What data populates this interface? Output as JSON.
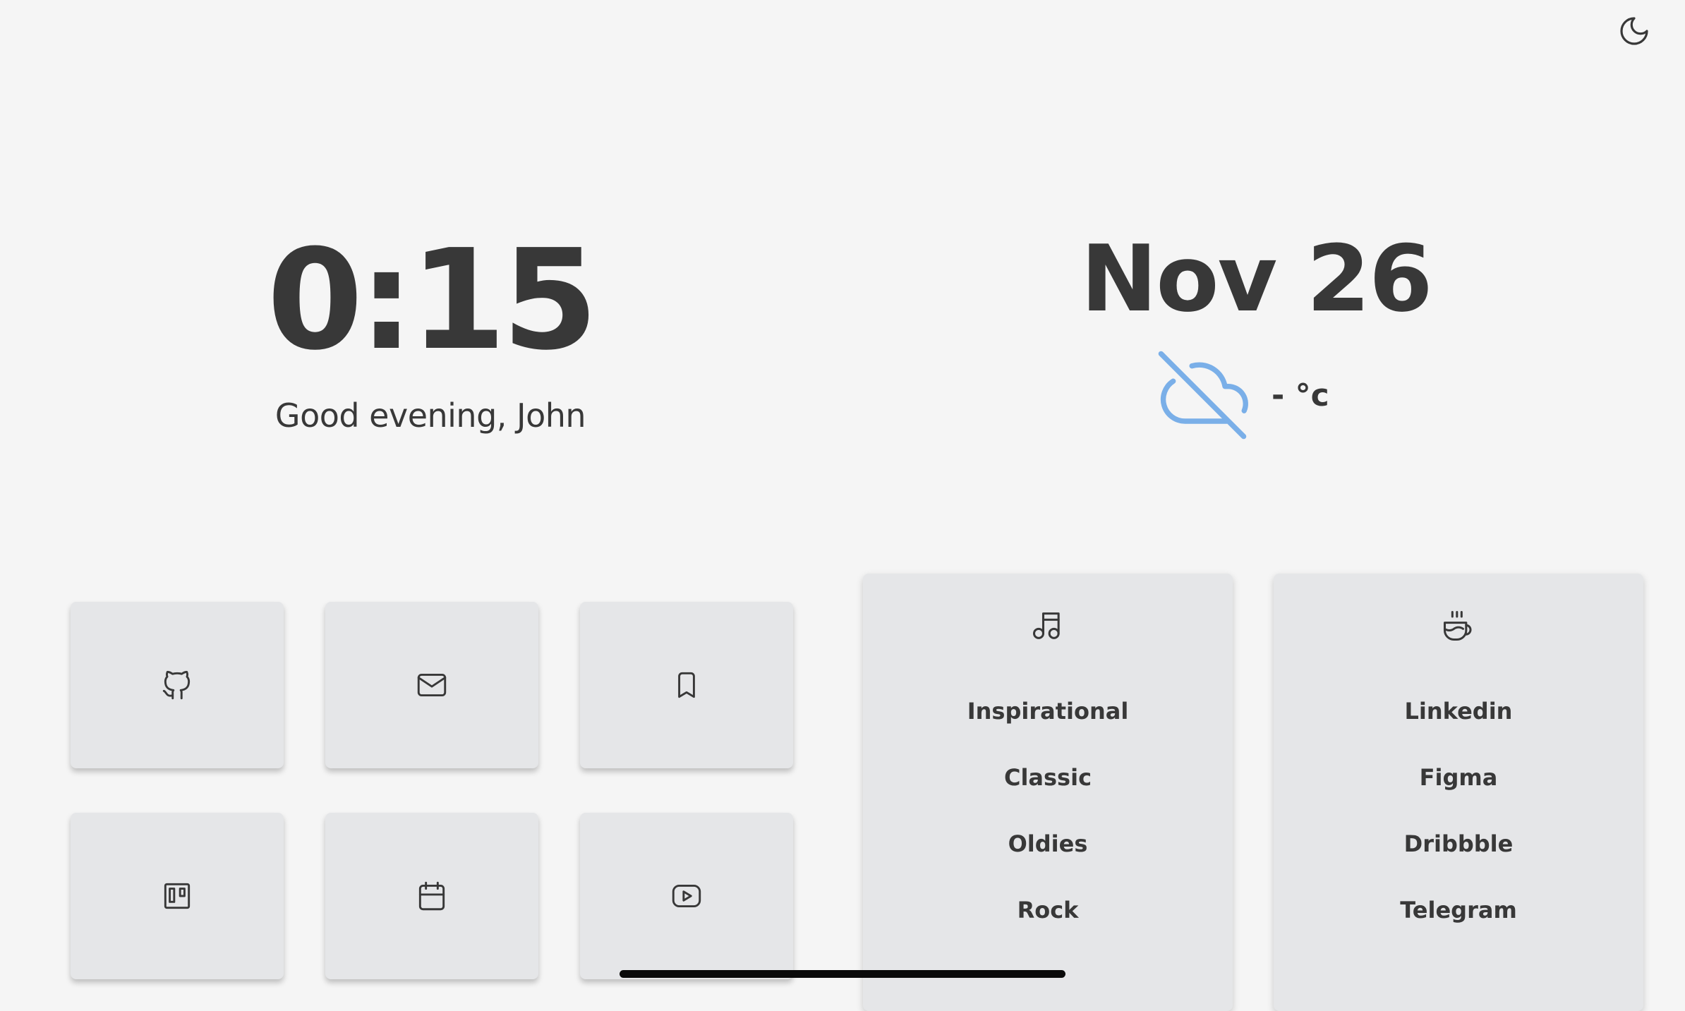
{
  "clock": {
    "time": "0:15",
    "greeting": "Good evening, John"
  },
  "date": {
    "text": "Nov 26"
  },
  "weather": {
    "temperature": "- °c",
    "icon": "cloud-off-icon",
    "icon_color": "#7aafe8"
  },
  "theme_toggle": {
    "icon": "moon-icon"
  },
  "shortcuts": [
    {
      "icon": "github-icon"
    },
    {
      "icon": "mail-icon"
    },
    {
      "icon": "bookmark-icon"
    },
    {
      "icon": "trello-icon"
    },
    {
      "icon": "calendar-icon"
    },
    {
      "icon": "youtube-icon"
    }
  ],
  "music_list": {
    "icon": "music-icon",
    "items": [
      "Inspirational",
      "Classic",
      "Oldies",
      "Rock"
    ]
  },
  "links_list": {
    "icon": "coffee-icon",
    "items": [
      "Linkedin",
      "Figma",
      "Dribbble",
      "Telegram"
    ]
  },
  "colors": {
    "background": "#f5f5f5",
    "card": "#e5e6e8",
    "text": "#383838"
  }
}
